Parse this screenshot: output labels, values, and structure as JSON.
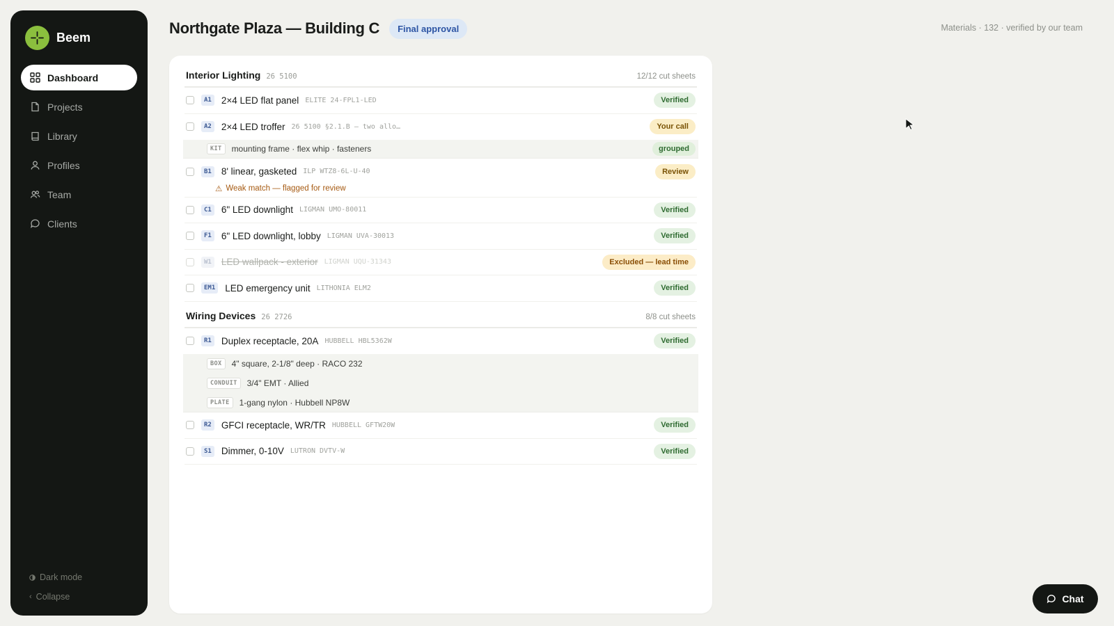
{
  "brand": {
    "name": "Beem"
  },
  "nav": [
    {
      "label": "Dashboard",
      "icon": "grid-icon",
      "active": true
    },
    {
      "label": "Projects",
      "icon": "file-icon"
    },
    {
      "label": "Library",
      "icon": "book-icon"
    },
    {
      "label": "Profiles",
      "icon": "user-icon"
    },
    {
      "label": "Team",
      "icon": "users-icon"
    },
    {
      "label": "Clients",
      "icon": "chat-bubble-icon"
    }
  ],
  "sidebar_footer": {
    "dark_mode": "Dark mode",
    "collapse": "Collapse"
  },
  "header": {
    "title": "Northgate Plaza — Building C",
    "badge": "Final approval",
    "meta": "Materials · 132 · verified by our team"
  },
  "sections": [
    {
      "title": "Interior Lighting",
      "code": "26 5100",
      "count": "12/12 cut sheets",
      "items": [
        {
          "tag": "A1",
          "name": "2×4 LED flat panel",
          "code": "ELITE 24-FPL1-LED",
          "status": "Verified"
        },
        {
          "tag": "A2",
          "name": "2×4 LED troffer",
          "code": "26 5100 §2.1.B — two allo…",
          "status": "Your call"
        },
        {
          "kit_tag": "KIT",
          "kit_text": "mounting frame · flex whip · fasteners",
          "kit_status": "grouped"
        },
        {
          "tag": "B1",
          "name": "8' linear, gasketed",
          "code": "ILP WTZ8-6L-U-40",
          "status": "Review",
          "warning": "Weak match — flagged for review"
        },
        {
          "tag": "C1",
          "name": "6\" LED downlight",
          "code": "LIGMAN UMO-80011",
          "status": "Verified"
        },
        {
          "tag": "F1",
          "name": "6\" LED downlight, lobby",
          "code": "LIGMAN UVA-30013",
          "status": "Verified"
        },
        {
          "tag": "W1",
          "name": "LED wallpack - exterior",
          "code": "LIGMAN UQU-31343",
          "status": "Excluded — lead time"
        },
        {
          "tag": "EM1",
          "name": "LED emergency unit",
          "code": "LITHONIA ELM2",
          "status": "Verified"
        }
      ]
    },
    {
      "title": "Wiring Devices",
      "code": "26 2726",
      "count": "8/8 cut sheets",
      "items": [
        {
          "tag": "R1",
          "name": "Duplex receptacle, 20A",
          "code": "HUBBELL HBL5362W",
          "status": "Verified"
        },
        {
          "sub_tag": "BOX",
          "sub_text": "4\" square, 2-1/8\" deep · RACO 232"
        },
        {
          "sub_tag": "CONDUIT",
          "sub_text": "3/4\" EMT · Allied"
        },
        {
          "sub_tag": "PLATE",
          "sub_text": "1-gang nylon · Hubbell NP8W"
        },
        {
          "tag": "R2",
          "name": "GFCI receptacle, WR/TR",
          "code": "HUBBELL GFTW20W",
          "status": "Verified"
        },
        {
          "tag": "S1",
          "name": "Dimmer, 0-10V",
          "code": "LUTRON DVTV-W",
          "status": "Verified"
        }
      ]
    }
  ],
  "chat": {
    "label": "Chat"
  },
  "colors": {
    "sidebar": "#141714",
    "accent": "#8bbf3e",
    "verified": "#2f6b31",
    "warning": "#a65a12",
    "badge_blue": "#2d55a4"
  }
}
